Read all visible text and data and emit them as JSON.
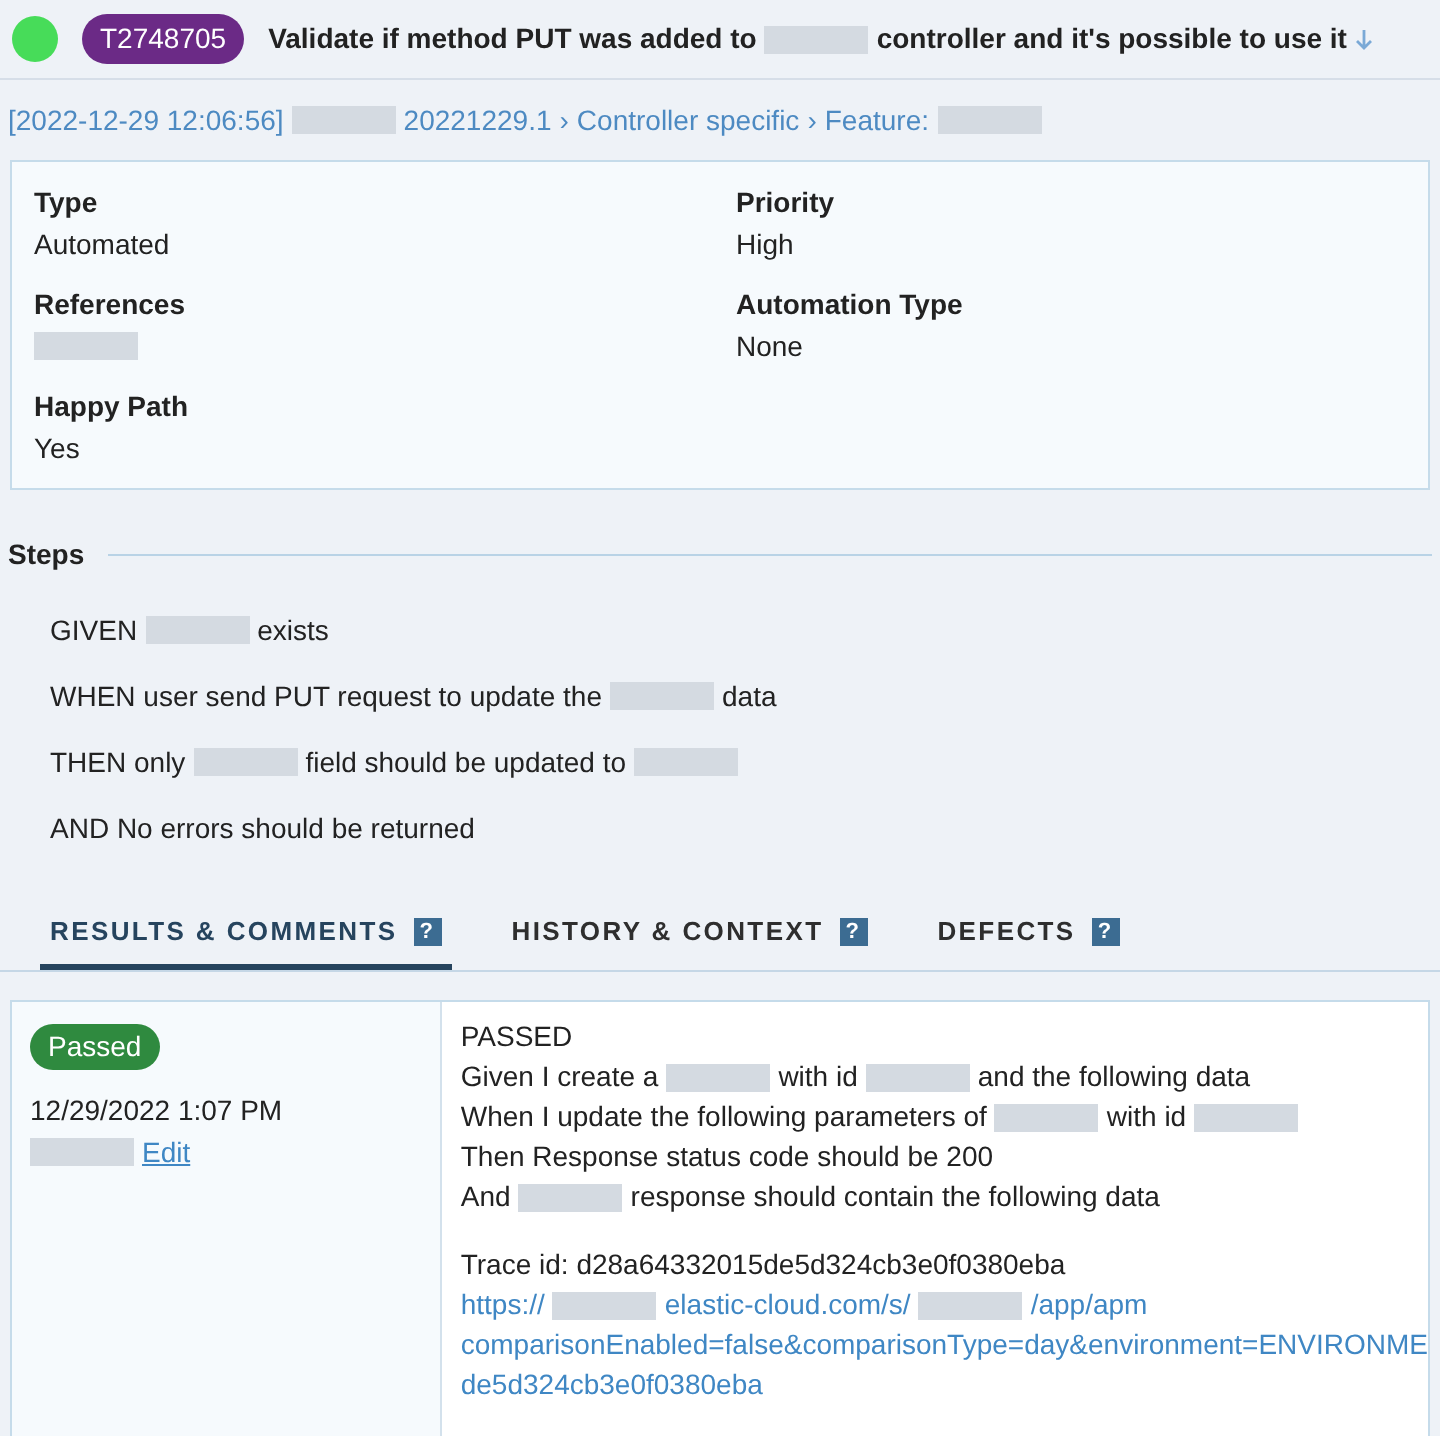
{
  "header": {
    "test_id": "T2748705",
    "title": [
      {
        "kind": "text",
        "text": "Validate if method PUT was added to"
      },
      {
        "kind": "redacted"
      },
      {
        "kind": "text",
        "text": "controller and it's possible to use it"
      }
    ]
  },
  "breadcrumb": [
    {
      "kind": "text",
      "text": "[2022-12-29 12:06:56]"
    },
    {
      "kind": "redacted"
    },
    {
      "kind": "text",
      "text": "20221229.1"
    },
    {
      "kind": "sep",
      "text": "›"
    },
    {
      "kind": "text",
      "text": "Controller specific"
    },
    {
      "kind": "sep",
      "text": "›"
    },
    {
      "kind": "text",
      "text": "Feature:"
    },
    {
      "kind": "redacted"
    }
  ],
  "fields": [
    {
      "label": "Type",
      "value": [
        {
          "kind": "text",
          "text": "Automated"
        }
      ]
    },
    {
      "label": "Priority",
      "value": [
        {
          "kind": "text",
          "text": "High"
        }
      ]
    },
    {
      "label": "References",
      "value": [
        {
          "kind": "redacted"
        }
      ]
    },
    {
      "label": "Automation Type",
      "value": [
        {
          "kind": "text",
          "text": "None"
        }
      ]
    },
    {
      "label": "Happy Path",
      "value": [
        {
          "kind": "text",
          "text": "Yes"
        }
      ]
    }
  ],
  "steps": {
    "title": "Steps",
    "lines": [
      [
        {
          "kind": "text",
          "text": "GIVEN"
        },
        {
          "kind": "redacted"
        },
        {
          "kind": "text",
          "text": "exists"
        }
      ],
      [
        {
          "kind": "text",
          "text": "WHEN user send PUT request to update the"
        },
        {
          "kind": "redacted"
        },
        {
          "kind": "text",
          "text": "data"
        }
      ],
      [
        {
          "kind": "text",
          "text": "THEN only"
        },
        {
          "kind": "redacted"
        },
        {
          "kind": "text",
          "text": "field should be updated to"
        },
        {
          "kind": "redacted"
        }
      ],
      [
        {
          "kind": "text",
          "text": "AND No errors should be returned"
        }
      ]
    ]
  },
  "tabs": [
    {
      "label": "RESULTS & COMMENTS",
      "help": "?",
      "selected": true
    },
    {
      "label": "HISTORY & CONTEXT",
      "help": "?",
      "selected": false
    },
    {
      "label": "DEFECTS",
      "help": "?",
      "selected": false
    }
  ],
  "result": {
    "status": "Passed",
    "date": "12/29/2022 1:07 PM",
    "author": [
      {
        "kind": "redacted"
      },
      {
        "kind": "link",
        "text": "Edit"
      }
    ],
    "lines": [
      [
        {
          "kind": "text",
          "text": "PASSED"
        }
      ],
      [
        {
          "kind": "text",
          "text": "Given I create a"
        },
        {
          "kind": "redacted"
        },
        {
          "kind": "text",
          "text": "with id"
        },
        {
          "kind": "redacted"
        },
        {
          "kind": "text",
          "text": "and the following data"
        }
      ],
      [
        {
          "kind": "text",
          "text": "When I update the following parameters of"
        },
        {
          "kind": "redacted"
        },
        {
          "kind": "text",
          "text": "with id"
        },
        {
          "kind": "redacted"
        }
      ],
      [
        {
          "kind": "text",
          "text": "Then Response status code should be 200"
        }
      ],
      [
        {
          "kind": "text",
          "text": "And"
        },
        {
          "kind": "redacted"
        },
        {
          "kind": "text",
          "text": "response should contain the following data"
        }
      ]
    ],
    "trace_lines": [
      [
        {
          "kind": "text",
          "text": "Trace id: d28a64332015de5d324cb3e0f0380eba"
        }
      ],
      [
        {
          "kind": "link",
          "text": "https://"
        },
        {
          "kind": "redacted"
        },
        {
          "kind": "link",
          "text": "elastic-cloud.com/s/"
        },
        {
          "kind": "redacted"
        },
        {
          "kind": "link",
          "text": "/app/apm"
        }
      ],
      [
        {
          "kind": "link",
          "text": "comparisonEnabled=false&comparisonType=day&environment=ENVIRONME"
        }
      ],
      [
        {
          "kind": "link",
          "text": "de5d324cb3e0f0380eba"
        }
      ]
    ]
  }
}
